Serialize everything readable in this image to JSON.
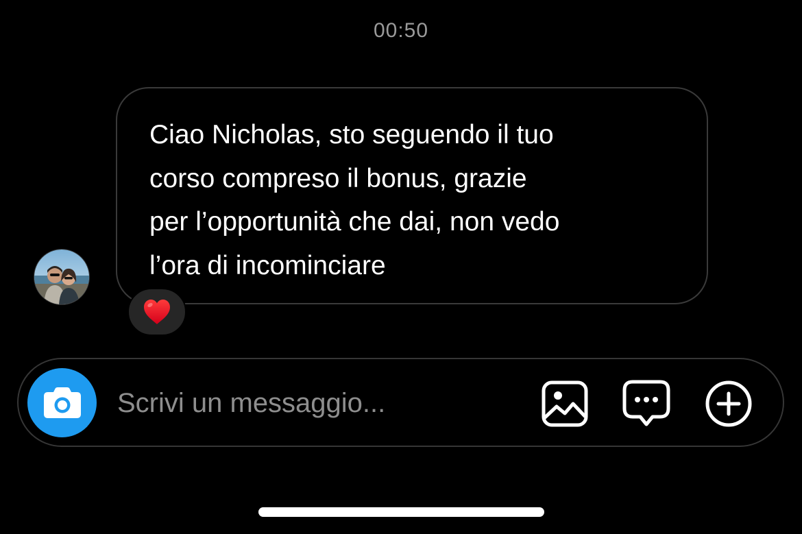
{
  "conversation": {
    "timestamp": "00:50",
    "message": {
      "text": "Ciao Nicholas, sto seguendo il tuo\ncorso compreso il bonus, grazie\nper l’opportunità che dai, non vedo\nl’ora di incominciare",
      "reaction": "❤️",
      "sender_avatar": "avatar-photo"
    }
  },
  "composer": {
    "placeholder": "Scrivi un messaggio...",
    "icons": {
      "camera": "camera-icon",
      "gallery": "image-icon",
      "sticker": "chat-bubble-icon",
      "add": "plus-circle-icon"
    }
  },
  "colors": {
    "background": "#000000",
    "camera_button": "#1e9bf0",
    "bubble_border": "#3a3a3a",
    "timestamp": "#9a9a9a",
    "reaction_bg": "#262626"
  }
}
